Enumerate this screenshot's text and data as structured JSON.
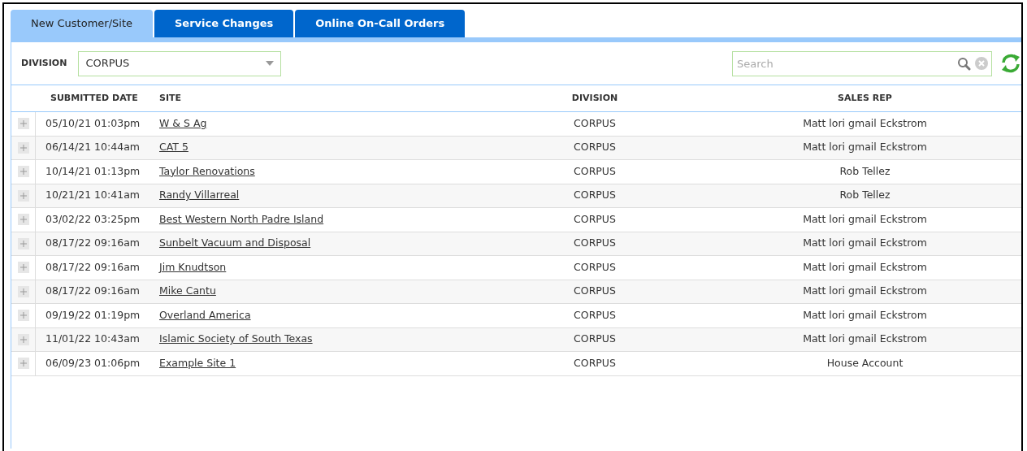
{
  "tabs": [
    {
      "label": "New Customer/Site",
      "selected": true
    },
    {
      "label": "Service Changes",
      "selected": false
    },
    {
      "label": "Online On-Call Orders",
      "selected": false
    }
  ],
  "toolbar": {
    "division_label": "DIVISION",
    "division_value": "CORPUS",
    "search": {
      "placeholder": "Search"
    }
  },
  "table": {
    "columns": [
      "SUBMITTED DATE",
      "SITE",
      "DIVISION",
      "SALES REP"
    ],
    "rows": [
      {
        "submitted_date": "05/10/21 01:03pm",
        "site": "W & S Ag",
        "division": "CORPUS",
        "sales_rep": "Matt lori gmail Eckstrom"
      },
      {
        "submitted_date": "06/14/21 10:44am",
        "site": "CAT 5",
        "division": "CORPUS",
        "sales_rep": "Matt lori gmail Eckstrom"
      },
      {
        "submitted_date": "10/14/21 01:13pm",
        "site": "Taylor Renovations",
        "division": "CORPUS",
        "sales_rep": "Rob Tellez"
      },
      {
        "submitted_date": "10/21/21 10:41am",
        "site": "Randy Villarreal",
        "division": "CORPUS",
        "sales_rep": "Rob Tellez"
      },
      {
        "submitted_date": "03/02/22 03:25pm",
        "site": "Best Western North Padre Island",
        "division": "CORPUS",
        "sales_rep": "Matt lori gmail Eckstrom"
      },
      {
        "submitted_date": "08/17/22 09:16am",
        "site": "Sunbelt Vacuum and Disposal",
        "division": "CORPUS",
        "sales_rep": "Matt lori gmail Eckstrom"
      },
      {
        "submitted_date": "08/17/22 09:16am",
        "site": "Jim Knudtson",
        "division": "CORPUS",
        "sales_rep": "Matt lori gmail Eckstrom"
      },
      {
        "submitted_date": "08/17/22 09:16am",
        "site": "Mike Cantu",
        "division": "CORPUS",
        "sales_rep": "Matt lori gmail Eckstrom"
      },
      {
        "submitted_date": "09/19/22 01:19pm",
        "site": "Overland America",
        "division": "CORPUS",
        "sales_rep": "Matt lori gmail Eckstrom"
      },
      {
        "submitted_date": "11/01/22 10:43am",
        "site": "Islamic Society of South Texas",
        "division": "CORPUS",
        "sales_rep": "Matt lori gmail Eckstrom"
      },
      {
        "submitted_date": "06/09/23 01:06pm",
        "site": "Example Site 1",
        "division": "CORPUS",
        "sales_rep": "House Account"
      }
    ]
  }
}
